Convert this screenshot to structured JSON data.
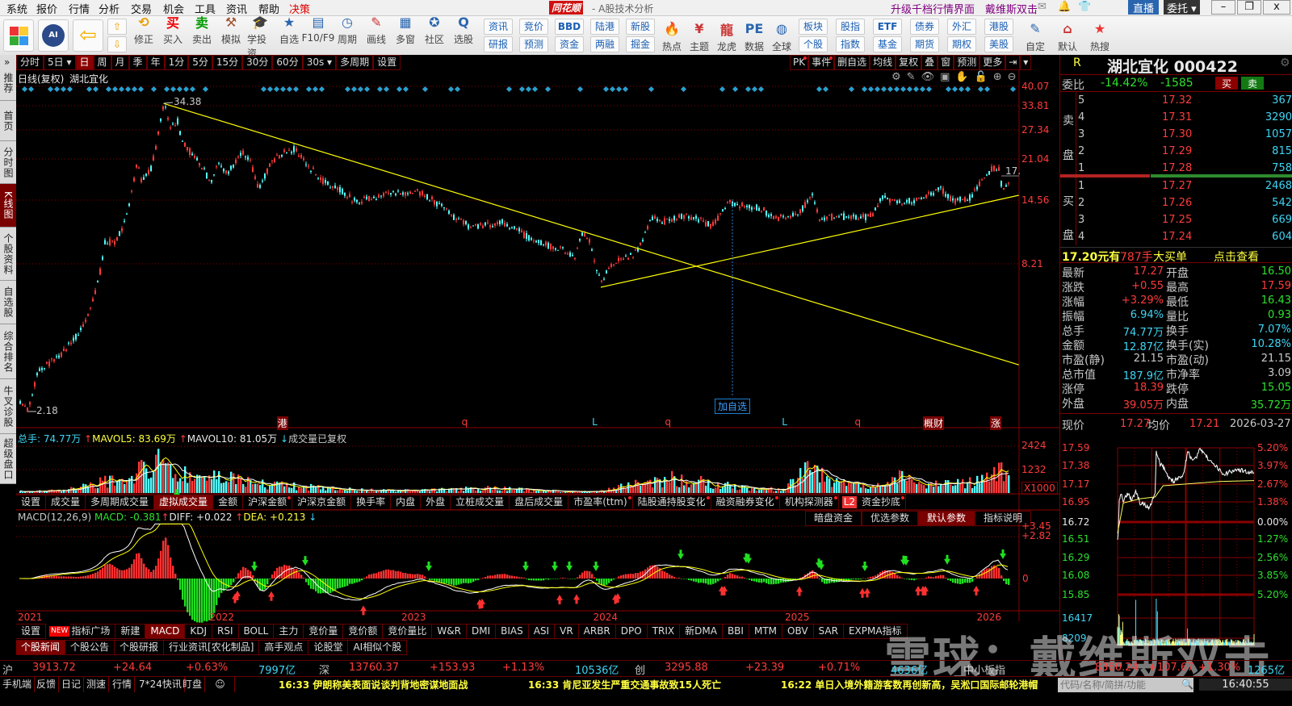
{
  "menu": {
    "items": [
      "系统",
      "报价",
      "行情",
      "分析",
      "交易",
      "机会",
      "工具",
      "资讯",
      "帮助"
    ],
    "decision": "决策",
    "logo": "同花顺",
    "app_subtitle": "- A股技术分析",
    "upgrade": "升级千档行情界面",
    "user": "戴维斯双击",
    "live": "直播",
    "entrust": "委托"
  },
  "toolbar": {
    "big": [
      "修正",
      "买入",
      "卖出",
      "模拟",
      "学投资",
      "自选",
      "F10/F9",
      "周期",
      "画线",
      "多窗",
      "社区",
      "选股"
    ],
    "pairs1": [
      [
        "资讯",
        "研报"
      ],
      [
        "竞价",
        "预测"
      ],
      [
        "BBD",
        "资金"
      ],
      [
        "陆港",
        "两融"
      ],
      [
        "新股",
        "掘金"
      ]
    ],
    "mid": [
      "热点",
      "主题",
      "龙虎",
      "数据",
      "全球"
    ],
    "pairs2": [
      [
        "板块",
        "个股"
      ],
      [
        "股指",
        "指数"
      ],
      [
        "ETF",
        "基金"
      ],
      [
        "债券",
        "期货"
      ],
      [
        "外汇",
        "期权"
      ],
      [
        "港股",
        "美股"
      ]
    ],
    "tail": [
      "自定",
      "默认",
      "热搜"
    ]
  },
  "sidebar": {
    "items": [
      "推荐",
      "首页",
      "分时图",
      "K线图",
      "个股资料",
      "自选股",
      "综合排名",
      "牛叉诊股",
      "超级盘口"
    ],
    "active": 3
  },
  "period_bar": {
    "items": [
      "分时",
      "5日 ▾",
      "日",
      "周",
      "月",
      "季",
      "年",
      "1分",
      "5分",
      "15分",
      "30分",
      "60分",
      "30s ▾",
      "多周期",
      "设置"
    ],
    "active": 2,
    "right": [
      "PK",
      "事件",
      "删自选",
      "均线",
      "复权",
      "叠",
      "窗",
      "预测",
      "更多",
      "⇥",
      "▾"
    ]
  },
  "chart": {
    "title": "日线(复权)",
    "name": "湖北宜化",
    "y_ticks": [
      "40.07",
      "33.81",
      "27.34",
      "21.04",
      "14.56",
      "8.21"
    ],
    "high_label": "34.38",
    "low_label": "2.18",
    "last_label": "17.",
    "add_watch": "加自选",
    "markers": [
      {
        "text": "港",
        "year": 2022.35,
        "color": "#fff",
        "bg": "#7a0000"
      },
      {
        "text": "q",
        "year": 2023.31,
        "color": "#ff3b3b"
      },
      {
        "text": "L",
        "year": 2023.99,
        "color": "#3fd5f5"
      },
      {
        "text": "q",
        "year": 2024.37,
        "color": "#ff3b3b"
      },
      {
        "text": "L",
        "year": 2024.98,
        "color": "#3fd5f5"
      },
      {
        "text": "q",
        "year": 2025.36,
        "color": "#ff3b3b"
      },
      {
        "text": "概财",
        "year": 2025.72,
        "color": "#fff",
        "bg": "#7a0000"
      },
      {
        "text": "涨",
        "year": 2026.07,
        "color": "#fff",
        "bg": "#7a0000"
      }
    ],
    "years": [
      "2021",
      "2022",
      "2023",
      "2024",
      "2025",
      "2026"
    ]
  },
  "chart_data": {
    "type": "candlestick",
    "price_path": [
      [
        2021.01,
        2.36
      ],
      [
        2021.05,
        2.2
      ],
      [
        2021.1,
        3.1
      ],
      [
        2021.16,
        3.38
      ],
      [
        2021.22,
        3.64
      ],
      [
        2021.29,
        4.2
      ],
      [
        2021.33,
        4.68
      ],
      [
        2021.37,
        5.4
      ],
      [
        2021.39,
        6.02
      ],
      [
        2021.42,
        7.21
      ],
      [
        2021.45,
        9.97
      ],
      [
        2021.5,
        9.97
      ],
      [
        2021.54,
        11.11
      ],
      [
        2021.57,
        13.11
      ],
      [
        2021.6,
        17.11
      ],
      [
        2021.62,
        20.49
      ],
      [
        2021.64,
        17.11
      ],
      [
        2021.69,
        19.07
      ],
      [
        2021.73,
        26.37
      ],
      [
        2021.75,
        32.72
      ],
      [
        2021.76,
        34.38
      ],
      [
        2021.79,
        27.33
      ],
      [
        2021.83,
        29.37
      ],
      [
        2021.85,
        24.53
      ],
      [
        2021.9,
        22.02
      ],
      [
        2021.94,
        20.49
      ],
      [
        2022.0,
        17.11
      ],
      [
        2022.04,
        19.77
      ],
      [
        2022.09,
        18.39
      ],
      [
        2022.13,
        20.49
      ],
      [
        2022.17,
        22.02
      ],
      [
        2022.21,
        20.49
      ],
      [
        2022.25,
        15.92
      ],
      [
        2022.32,
        20.49
      ],
      [
        2022.38,
        22.02
      ],
      [
        2022.44,
        22.9
      ],
      [
        2022.51,
        19.77
      ],
      [
        2022.59,
        17.11
      ],
      [
        2022.68,
        15.92
      ],
      [
        2022.76,
        14.3
      ],
      [
        2022.84,
        14.82
      ],
      [
        2022.93,
        15.36
      ],
      [
        2023.01,
        15.36
      ],
      [
        2023.08,
        15.58
      ],
      [
        2023.14,
        14.82
      ],
      [
        2023.2,
        13.79
      ],
      [
        2023.27,
        12.38
      ],
      [
        2023.35,
        11.52
      ],
      [
        2023.43,
        11.52
      ],
      [
        2023.52,
        11.94
      ],
      [
        2023.6,
        11.11
      ],
      [
        2023.69,
        9.97
      ],
      [
        2023.77,
        9.62
      ],
      [
        2023.85,
        9.27
      ],
      [
        2023.9,
        8.63
      ],
      [
        2023.94,
        10.72
      ],
      [
        2023.98,
        9.97
      ],
      [
        2024.01,
        7.75
      ],
      [
        2024.05,
        6.95
      ],
      [
        2024.07,
        8.03
      ],
      [
        2024.15,
        8.63
      ],
      [
        2024.21,
        8.95
      ],
      [
        2024.25,
        9.97
      ],
      [
        2024.3,
        12.38
      ],
      [
        2024.36,
        11.94
      ],
      [
        2024.44,
        12.55
      ],
      [
        2024.53,
        12.38
      ],
      [
        2024.61,
        11.52
      ],
      [
        2024.65,
        12.38
      ],
      [
        2024.7,
        14.3
      ],
      [
        2024.74,
        13.79
      ],
      [
        2024.78,
        13.79
      ],
      [
        2024.87,
        13.49
      ],
      [
        2024.93,
        12.38
      ],
      [
        2024.99,
        12.38
      ],
      [
        2025.08,
        13.11
      ],
      [
        2025.14,
        15.36
      ],
      [
        2025.18,
        11.94
      ],
      [
        2025.22,
        12.38
      ],
      [
        2025.29,
        12.55
      ],
      [
        2025.37,
        12.38
      ],
      [
        2025.45,
        12.55
      ],
      [
        2025.5,
        14.82
      ],
      [
        2025.58,
        14.3
      ],
      [
        2025.67,
        14.5
      ],
      [
        2025.75,
        15.36
      ],
      [
        2025.81,
        15.92
      ],
      [
        2025.88,
        14.3
      ],
      [
        2025.96,
        14.82
      ],
      [
        2026.02,
        17.11
      ],
      [
        2026.07,
        19.07
      ],
      [
        2026.11,
        19.34
      ],
      [
        2026.13,
        15.92
      ],
      [
        2026.17,
        17.27
      ]
    ],
    "trendlines": [
      [
        [
          2021.76,
          34.38
        ],
        [
          2026.22,
          3.33
        ]
      ],
      [
        [
          2024.04,
          6.66
        ],
        [
          2026.22,
          15.14
        ]
      ]
    ],
    "volume_envelope": [
      [
        2021.0,
        80
      ],
      [
        2021.2,
        150
      ],
      [
        2021.4,
        600
      ],
      [
        2021.6,
        1200
      ],
      [
        2021.75,
        1900
      ],
      [
        2021.9,
        1000
      ],
      [
        2022.1,
        900
      ],
      [
        2022.3,
        500
      ],
      [
        2022.6,
        300
      ],
      [
        2022.9,
        150
      ],
      [
        2023.2,
        200
      ],
      [
        2023.5,
        300
      ],
      [
        2023.7,
        150
      ],
      [
        2023.9,
        100
      ],
      [
        2024.0,
        80
      ],
      [
        2024.2,
        500
      ],
      [
        2024.4,
        900
      ],
      [
        2024.6,
        600
      ],
      [
        2024.8,
        300
      ],
      [
        2025.0,
        200
      ],
      [
        2025.1,
        1900
      ],
      [
        2025.2,
        900
      ],
      [
        2025.4,
        500
      ],
      [
        2025.5,
        400
      ],
      [
        2025.6,
        1000
      ],
      [
        2025.8,
        500
      ],
      [
        2026.0,
        700
      ],
      [
        2026.1,
        1300
      ],
      [
        2026.17,
        1100
      ]
    ],
    "volume_ylim": [
      0,
      2424
    ],
    "macd_ylim": [
      -3.45,
      3.45
    ]
  },
  "volume": {
    "total_label": "总手: 74.77万",
    "mavol5": "MAVOL5: 83.69万",
    "mavol10": "MAVOL10: 81.05万",
    "adj": "成交量已复权",
    "ticks": [
      "2424",
      "1232"
    ],
    "unit": "X1000",
    "tabs": [
      "设置",
      "成交量",
      "多周期成交量",
      "虚拟成交量",
      "金额",
      "沪深金额",
      "沪深京金额",
      "换手率",
      "内盘",
      "外盘",
      "立桩成交量",
      "盘后成交量",
      "市盈率(ttm)",
      "陆股通持股变化",
      "融资融券变化",
      "机构探测器",
      "L2",
      "资金抄底"
    ],
    "active": 3,
    "dots": [
      5,
      12,
      13,
      14,
      15,
      17
    ]
  },
  "macd": {
    "name": "MACD(12,26,9)",
    "macd": "MACD: -0.381",
    "diff": "DIFF: +0.022",
    "dea": "DEA: +0.213",
    "ticks": [
      "+3.45",
      "+2.82",
      "0"
    ],
    "buttons": [
      "暗盘资金",
      "优选参数",
      "默认参数",
      "指标说明"
    ],
    "active_button": 2
  },
  "indicator_tabs": {
    "items": [
      "设置",
      "NEW",
      "指标广场",
      "新建",
      "MACD",
      "KDJ",
      "RSI",
      "BOLL",
      "主力",
      "竞价量",
      "竞价额",
      "竞价量比",
      "W&R",
      "DMI",
      "BIAS",
      "ASI",
      "VR",
      "ARBR",
      "DPO",
      "TRIX",
      "新DMA",
      "BBI",
      "MTM",
      "OBV",
      "SAR",
      "EXPMA指标"
    ],
    "active": 4
  },
  "news_tabs": {
    "items": [
      "个股新闻",
      "个股公告",
      "个股研报",
      "行业资讯[农化制品]",
      "高手观点",
      "论股堂",
      "AI相似个股"
    ],
    "active": 0
  },
  "quote": {
    "flag": "R",
    "title": "湖北宜化 000422",
    "weibi_label": "委比",
    "weibi_pct": "-14.42%",
    "weibi_diff": "-1585",
    "buy_btn": "买",
    "sell_btn": "卖",
    "sell_label": [
      "卖",
      "盘"
    ],
    "buy_label": [
      "买",
      "盘"
    ],
    "asks": [
      {
        "lv": "5",
        "price": "17.32",
        "vol": "367"
      },
      {
        "lv": "4",
        "price": "17.31",
        "vol": "3290"
      },
      {
        "lv": "3",
        "price": "17.30",
        "vol": "1057"
      },
      {
        "lv": "2",
        "price": "17.29",
        "vol": "815"
      },
      {
        "lv": "1",
        "price": "17.28",
        "vol": "758"
      }
    ],
    "bids": [
      {
        "lv": "1",
        "price": "17.27",
        "vol": "2468"
      },
      {
        "lv": "2",
        "price": "17.26",
        "vol": "542"
      },
      {
        "lv": "3",
        "price": "17.25",
        "vol": "669"
      },
      {
        "lv": "4",
        "price": "17.24",
        "vol": "604"
      }
    ],
    "big_order": {
      "price": "17.20元有",
      "qty": "787手",
      "label": "大买单",
      "link": "点击查看"
    },
    "stats": [
      [
        "最新",
        "17.27",
        "red",
        "开盘",
        "16.50",
        "grn"
      ],
      [
        "涨跌",
        "+0.55",
        "red",
        "最高",
        "17.59",
        "red"
      ],
      [
        "涨幅",
        "+3.29%",
        "red",
        "最低",
        "16.43",
        "grn"
      ],
      [
        "振幅",
        "6.94%",
        "cyan",
        "量比",
        "0.93",
        "grn"
      ],
      [
        "总手",
        "74.77万",
        "cyan",
        "换手",
        "7.07%",
        "cyan"
      ],
      [
        "金额",
        "12.87亿",
        "cyan",
        "换手(实)",
        "10.28%",
        "cyan"
      ],
      [
        "市盈(静)",
        "21.15",
        "gry",
        "市盈(动)",
        "21.15",
        "gry"
      ],
      [
        "总市值",
        "187.9亿",
        "cyan",
        "市净率",
        "3.09",
        "gry"
      ],
      [
        "涨停",
        "18.39",
        "red",
        "跌停",
        "15.05",
        "grn"
      ],
      [
        "外盘",
        "39.05万",
        "red",
        "内盘",
        "35.72万",
        "grn"
      ]
    ],
    "intraday": {
      "now_label": "现价",
      "now": "17.27",
      "avg_label": "均价",
      "avg": "17.21",
      "date": "2026-03-27",
      "left_ticks": [
        "17.59",
        "17.38",
        "17.17",
        "16.95",
        "16.72",
        "16.51",
        "16.29",
        "16.08",
        "15.85"
      ],
      "right_ticks": [
        "5.20%",
        "3.97%",
        "2.67%",
        "1.38%",
        "0.00%",
        "1.27%",
        "2.56%",
        "3.85%",
        "5.20%"
      ],
      "vol_ticks": [
        "16417",
        "8209"
      ],
      "price_path": [
        [
          0,
          16.52
        ],
        [
          1,
          16.6
        ],
        [
          3,
          17.0
        ],
        [
          6,
          17.05
        ],
        [
          10,
          16.98
        ],
        [
          18,
          17.06
        ],
        [
          25,
          16.98
        ],
        [
          32,
          17.08
        ],
        [
          40,
          16.95
        ],
        [
          50,
          16.92
        ],
        [
          56,
          16.88
        ],
        [
          62,
          17.0
        ],
        [
          66,
          17.05
        ],
        [
          68,
          17.55
        ],
        [
          75,
          17.4
        ],
        [
          82,
          17.35
        ],
        [
          89,
          17.25
        ],
        [
          98,
          17.2
        ],
        [
          110,
          17.25
        ],
        [
          117,
          17.3
        ],
        [
          123,
          17.55
        ],
        [
          131,
          17.45
        ],
        [
          140,
          17.5
        ],
        [
          145,
          17.58
        ],
        [
          160,
          17.45
        ],
        [
          170,
          17.4
        ],
        [
          179,
          17.33
        ],
        [
          188,
          17.28
        ],
        [
          200,
          17.32
        ],
        [
          216,
          17.33
        ],
        [
          230,
          17.31
        ],
        [
          240,
          17.3
        ]
      ],
      "avg_path": [
        [
          0,
          16.6
        ],
        [
          10,
          16.95
        ],
        [
          40,
          17.0
        ],
        [
          66,
          17.02
        ],
        [
          80,
          17.15
        ],
        [
          120,
          17.17
        ],
        [
          180,
          17.2
        ],
        [
          240,
          17.21
        ]
      ],
      "vol_spikes": [
        [
          2,
          11000
        ],
        [
          3,
          10500
        ],
        [
          32,
          16000
        ],
        [
          68,
          16417
        ],
        [
          70,
          12000
        ],
        [
          123,
          6000
        ],
        [
          240,
          4000
        ]
      ]
    }
  },
  "watermark": "雪球：戴维斯双击",
  "index_bar": [
    {
      "name": "沪",
      "value": "3913.72",
      "chg": "+24.64",
      "pct": "+0.63%",
      "amt": "7997亿"
    },
    {
      "name": "深",
      "value": "13760.37",
      "chg": "+153.93",
      "pct": "+1.13%",
      "amt": "10536亿"
    },
    {
      "name": "创",
      "value": "3295.88",
      "chg": "+23.39",
      "pct": "+0.71%",
      "amt": "4636亿"
    },
    {
      "name": "中小板指",
      "value": "8360.24",
      "chg": "+107.67",
      "pct": "+1.30%",
      "amt": "1265亿"
    }
  ],
  "status": {
    "items": [
      "手机端",
      "反馈",
      "日记",
      "测速",
      "行情",
      "7*24快讯",
      "盯盘"
    ],
    "news": [
      "16:33 伊朗称美表面说谈判背地密谋地面战",
      "16:33 肯尼亚发生严重交通事故致15人死亡",
      "16:22 单日入境外籍游客数再创新高，吴淞口国际邮轮港帽"
    ],
    "search_placeholder": "代码/名称/简拼/功能",
    "clock": "16:40:55"
  },
  "colors": {
    "up": "#ff3b3b",
    "down": "#54ffff",
    "grid": "#8b0000",
    "trend": "#ffff00",
    "ma_white": "#ffffff",
    "ma_yellow": "#ffff00"
  }
}
